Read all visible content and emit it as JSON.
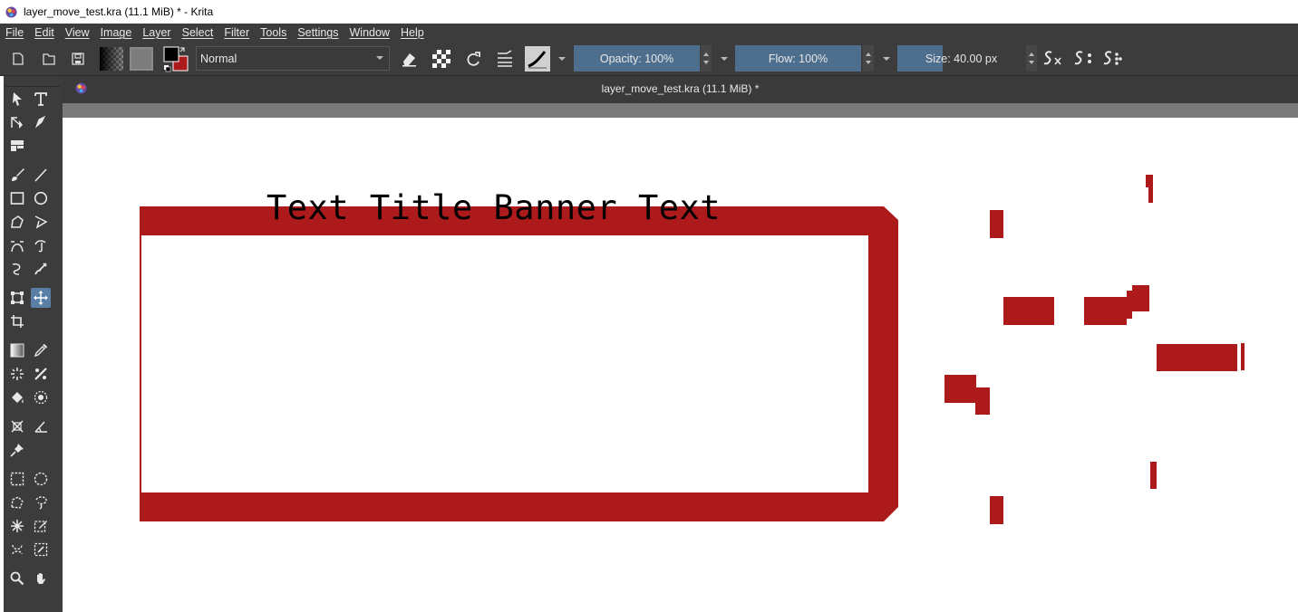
{
  "window": {
    "title": "layer_move_test.kra (11.1 MiB) * - Krita"
  },
  "menu": [
    "File",
    "Edit",
    "View",
    "Image",
    "Layer",
    "Select",
    "Filter",
    "Tools",
    "Settings",
    "Window",
    "Help"
  ],
  "toolbar": {
    "blend_mode": "Normal",
    "opacity_label": "Opacity: 100%",
    "flow_label": "Flow: 100%",
    "size_label": "Size: 40.00 px"
  },
  "document": {
    "tab_title": "layer_move_test.kra (11.1 MiB) *"
  },
  "canvas": {
    "banner_text": "Text Title Banner Text"
  },
  "colors": {
    "accent": "#ad1a1c",
    "ui_dark": "#3c3c3c",
    "slider": "#4e6e8e",
    "active_tool": "#5a7fa6"
  }
}
